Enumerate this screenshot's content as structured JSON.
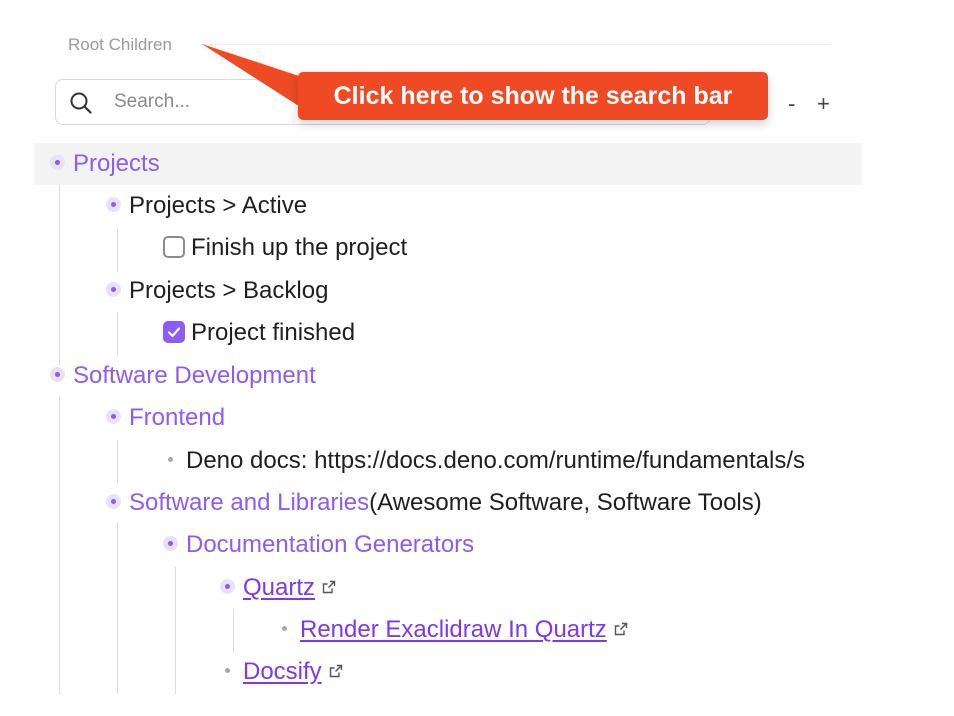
{
  "header": {
    "root_label": "Root Children"
  },
  "search": {
    "placeholder": "Search...",
    "value": ""
  },
  "controls": {
    "collapse_label": "-",
    "expand_label": "+"
  },
  "tooltip": {
    "text": "Click here to show the search bar"
  },
  "colors": {
    "accent": "#8b5cf6",
    "tooltip_bg": "#f04a24",
    "guide": "#dcdcdc",
    "highlight": "#f3f3f3"
  },
  "tree": {
    "projects": {
      "label": "Projects"
    },
    "projects_active": {
      "label": "Projects > Active"
    },
    "finish_project": {
      "label": "Finish up the project",
      "checked": false
    },
    "projects_backlog": {
      "label": "Projects > Backlog"
    },
    "project_finished": {
      "label": "Project finished",
      "checked": true
    },
    "software_dev": {
      "label": "Software Development"
    },
    "frontend": {
      "label": "Frontend"
    },
    "deno_docs": {
      "label": "Deno docs: https://docs.deno.com/runtime/fundamentals/s"
    },
    "software_libraries": {
      "label": "Software and Libraries",
      "aliases": "(Awesome Software, Software Tools)"
    },
    "doc_generators": {
      "label": "Documentation Generators"
    },
    "quartz": {
      "label": "Quartz",
      "icon": "external-link-icon"
    },
    "render_excalidraw": {
      "label": "Render Exaclidraw In Quartz",
      "icon": "external-link-icon"
    },
    "docsify": {
      "label": "Docsify",
      "icon": "external-link-icon"
    }
  }
}
